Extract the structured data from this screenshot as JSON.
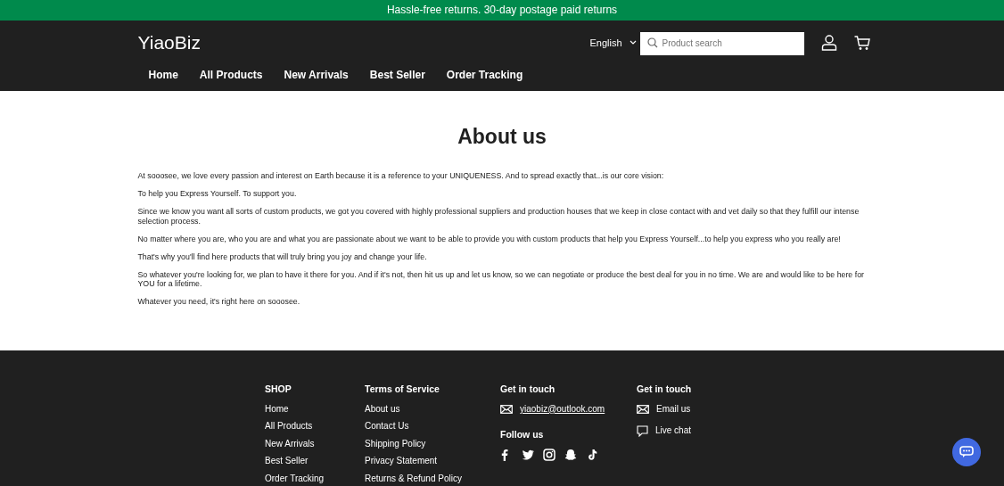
{
  "announcement": "Hassle-free returns. 30-day postage paid returns",
  "header": {
    "logo": "YiaoBiz",
    "language": "English",
    "search": {
      "placeholder": "Product search"
    }
  },
  "nav": [
    {
      "label": "Home"
    },
    {
      "label": "All Products"
    },
    {
      "label": "New Arrivals"
    },
    {
      "label": "Best Seller"
    },
    {
      "label": "Order Tracking"
    }
  ],
  "page": {
    "title": "About us",
    "paragraphs": [
      "At sooosee, we love every passion and interest on Earth because it is a reference to your UNIQUENESS. And to spread exactly that...is our core vision:",
      "To help you Express Yourself. To support you.",
      "Since we know you want all sorts of custom products, we got you covered with highly professional suppliers and production houses that we keep in close contact with and vet daily so that they fulfill our intense selection process.",
      "No matter where you are, who you are and what you are passionate about we want to be able to provide you with custom products that help you Express Yourself...to help you express who you really are!",
      "That's why you'll find here products that will truly bring you joy and change your life.",
      "So whatever you're looking for, we plan to have it there for you. And if it's not, then hit us up and let us know, so we can negotiate or produce the best deal for you in no time. We are and would like to be here for YOU for a lifetime.",
      "Whatever you need, it's right here on sooosee."
    ]
  },
  "footer": {
    "shop": {
      "title": "SHOP",
      "links": [
        "Home",
        "All Products",
        "New Arrivals",
        "Best Seller",
        "Order Tracking"
      ]
    },
    "terms": {
      "title": "Terms of Service",
      "links": [
        "About us",
        "Contact Us",
        "Shipping Policy",
        "Privacy Statement",
        "Returns & Refund Policy"
      ]
    },
    "contact": {
      "title": "Get in touch",
      "email": "yiaobiz@outlook.com",
      "follow_title": "Follow us",
      "social": [
        {
          "kind": "facebook"
        },
        {
          "kind": "twitter"
        },
        {
          "kind": "instagram"
        },
        {
          "kind": "snapchat"
        },
        {
          "kind": "tiktok"
        }
      ]
    },
    "contact2": {
      "title": "Get in touch",
      "items": [
        {
          "kind": "mail",
          "label": "Email us"
        },
        {
          "kind": "chat",
          "label": "Live chat"
        }
      ]
    }
  }
}
